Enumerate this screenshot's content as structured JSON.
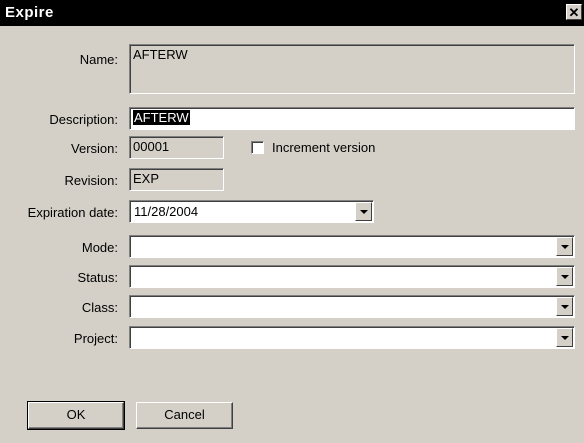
{
  "window": {
    "title": "Expire",
    "close_glyph": "✕"
  },
  "fields": {
    "name": {
      "label": "Name:",
      "value": "AFTERW"
    },
    "description": {
      "label": "Description:",
      "value": "AFTERW"
    },
    "version": {
      "label": "Version:",
      "value": "00001"
    },
    "increment_version": {
      "label": "Increment version",
      "checked": false
    },
    "revision": {
      "label": "Revision:",
      "value": "EXP"
    },
    "expiration_date": {
      "label": "Expiration date:",
      "value": "11/28/2004"
    },
    "mode": {
      "label": "Mode:",
      "value": ""
    },
    "status": {
      "label": "Status:",
      "value": ""
    },
    "class": {
      "label": "Class:",
      "value": ""
    },
    "project": {
      "label": "Project:",
      "value": ""
    }
  },
  "buttons": {
    "ok": "OK",
    "cancel": "Cancel"
  }
}
